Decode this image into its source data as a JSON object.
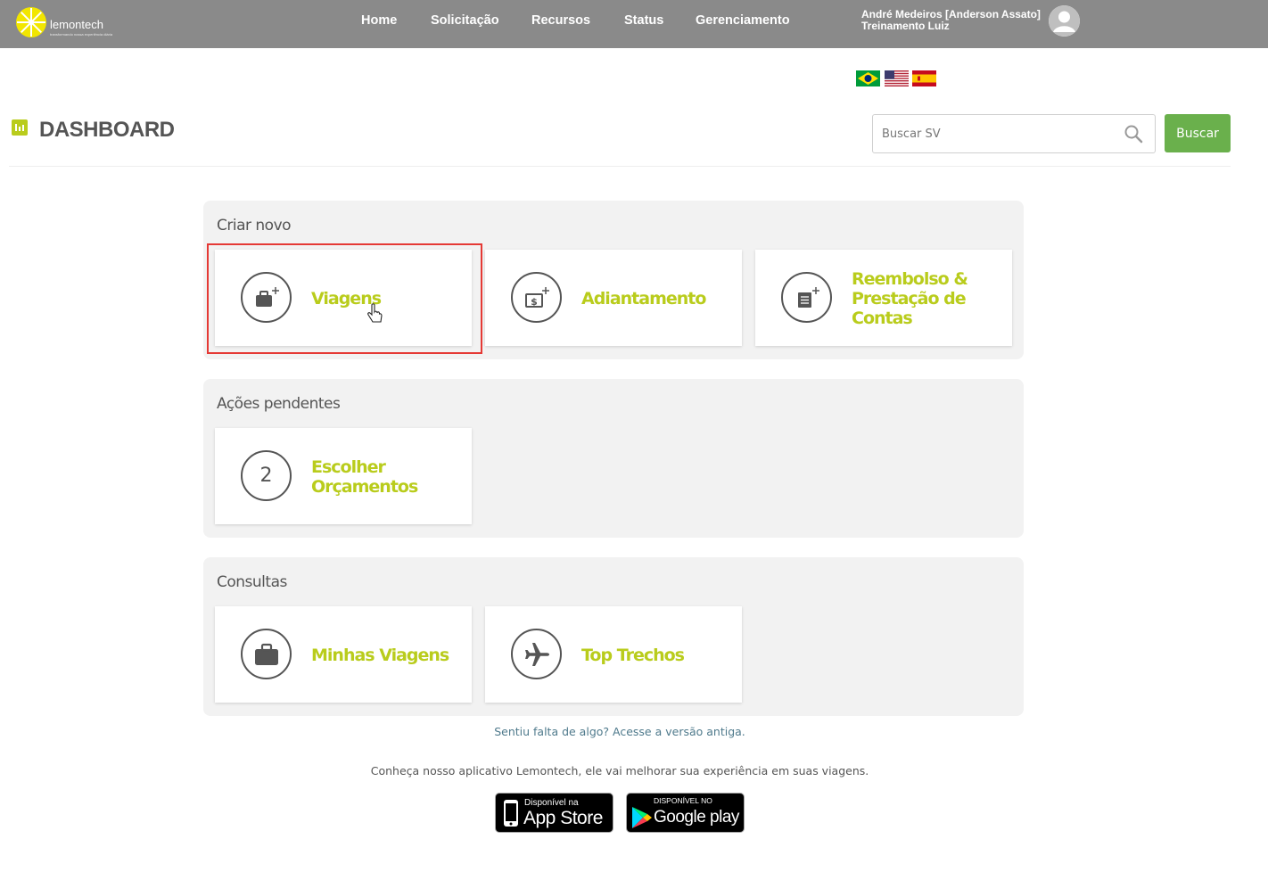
{
  "brand": {
    "name": "lemontech",
    "tagline": "transformando nossa experiência diária"
  },
  "nav": [
    {
      "label": "Home"
    },
    {
      "label": "Solicitação"
    },
    {
      "label": "Recursos"
    },
    {
      "label": "Status"
    },
    {
      "label": "Gerenciamento"
    }
  ],
  "user": {
    "line1": "André Medeiros [Anderson Assato]",
    "line2": "Treinamento Luiz"
  },
  "languages": [
    "Português (Brasil)",
    "English (US)",
    "Español"
  ],
  "page": {
    "title": "DASHBOARD"
  },
  "search": {
    "placeholder": "Buscar SV",
    "button": "Buscar"
  },
  "sections": {
    "create": {
      "title": "Criar novo",
      "cards": [
        {
          "label": "Viagens",
          "icon": "briefcase-plus-icon"
        },
        {
          "label": "Adiantamento",
          "icon": "money-plus-icon"
        },
        {
          "label": "Reembolso & Prestação de Contas",
          "lines": [
            "Reembolso &",
            "Prestação de",
            "Contas"
          ],
          "icon": "receipt-plus-icon"
        }
      ]
    },
    "pending": {
      "title": "Ações pendentes",
      "cards": [
        {
          "count": "2",
          "lines": [
            "Escolher",
            "Orçamentos"
          ]
        }
      ]
    },
    "queries": {
      "title": "Consultas",
      "cards": [
        {
          "label": "Minhas Viagens",
          "icon": "briefcase-icon"
        },
        {
          "label": "Top Trechos",
          "icon": "airplane-icon"
        }
      ]
    }
  },
  "footer": {
    "link": "Sentiu falta de algo? Acesse a versão antiga.",
    "promo": "Conheça nosso aplicativo Lemontech, ele vai melhorar sua experiência em suas viagens.",
    "appstore": {
      "small": "Disponível na",
      "big": "App Store"
    },
    "googleplay": {
      "small": "DISPONÍVEL NO",
      "big": "Google play"
    }
  },
  "colors": {
    "topbar": "#8a8a8a",
    "accent": "#b9cc1c",
    "button": "#6ab04c",
    "highlight": "#e53935"
  }
}
